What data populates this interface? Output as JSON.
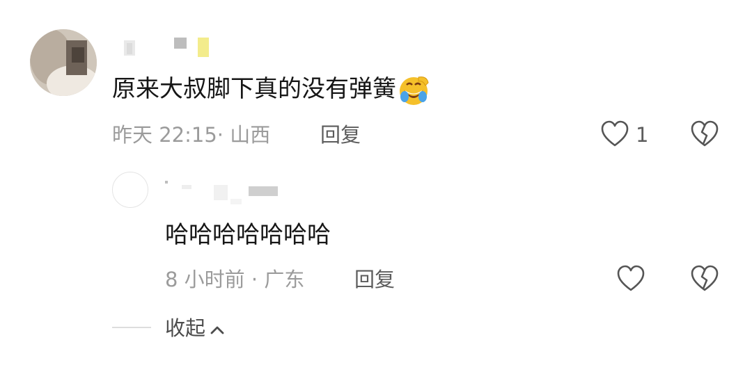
{
  "comment": {
    "text": "原来大叔脚下真的没有弹簧",
    "emoji": "rolling-on-floor-laughing-emoji",
    "time_location": "昨天 22:15· 山西",
    "reply_label": "回复",
    "like_count": "1"
  },
  "reply": {
    "text": "哈哈哈哈哈哈哈",
    "time_location": "8 小时前 · 广东",
    "reply_label": "回复"
  },
  "collapse_label": "收起",
  "colors": {
    "text": "#161616",
    "meta": "#9b9b9b",
    "action": "#5c5c5c",
    "icon": "#555555"
  }
}
